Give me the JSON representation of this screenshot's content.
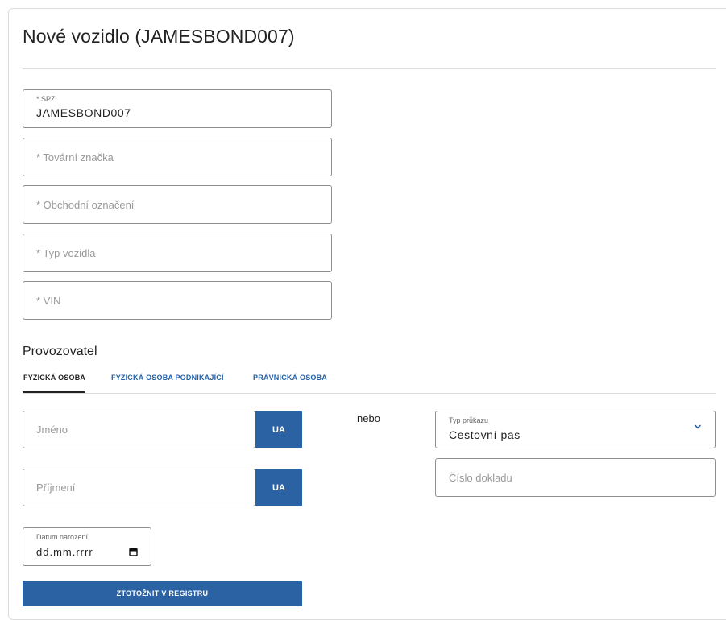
{
  "page": {
    "title": "Nové vozidlo (JAMESBOND007)"
  },
  "vehicle": {
    "spz": {
      "label": "* SPZ",
      "value": "JAMESBOND007"
    },
    "brand": {
      "placeholder": "* Tovární značka"
    },
    "trade_name": {
      "placeholder": "* Obchodní označení"
    },
    "vehicle_type": {
      "placeholder": "* Typ vozidla"
    },
    "vin": {
      "placeholder": "* VIN"
    }
  },
  "operator": {
    "section_title": "Provozovatel",
    "tabs": [
      {
        "label": "FYZICKÁ OSOBA",
        "active": true
      },
      {
        "label": "FYZICKÁ OSOBA PODNIKAJÍCÍ",
        "active": false
      },
      {
        "label": "PRÁVNICKÁ OSOBA",
        "active": false
      }
    ],
    "first_name": {
      "placeholder": "Jméno",
      "ua_label": "UA"
    },
    "last_name": {
      "placeholder": "Příjmení",
      "ua_label": "UA"
    },
    "birth_date": {
      "label": "Datum narození",
      "value": "dd.mm.rrrr",
      "icon": "calendar-icon"
    },
    "or_text": "nebo",
    "id_type": {
      "label": "Typ průkazu",
      "value": "Cestovní pas",
      "icon": "chevron-down-icon"
    },
    "document_number": {
      "placeholder": "Číslo dokladu"
    },
    "verify_button": "ZTOTOŽNIT V REGISTRU"
  },
  "colors": {
    "primary": "#2b62a3",
    "tab_link": "#2462a8",
    "border": "#8f8f8f"
  }
}
